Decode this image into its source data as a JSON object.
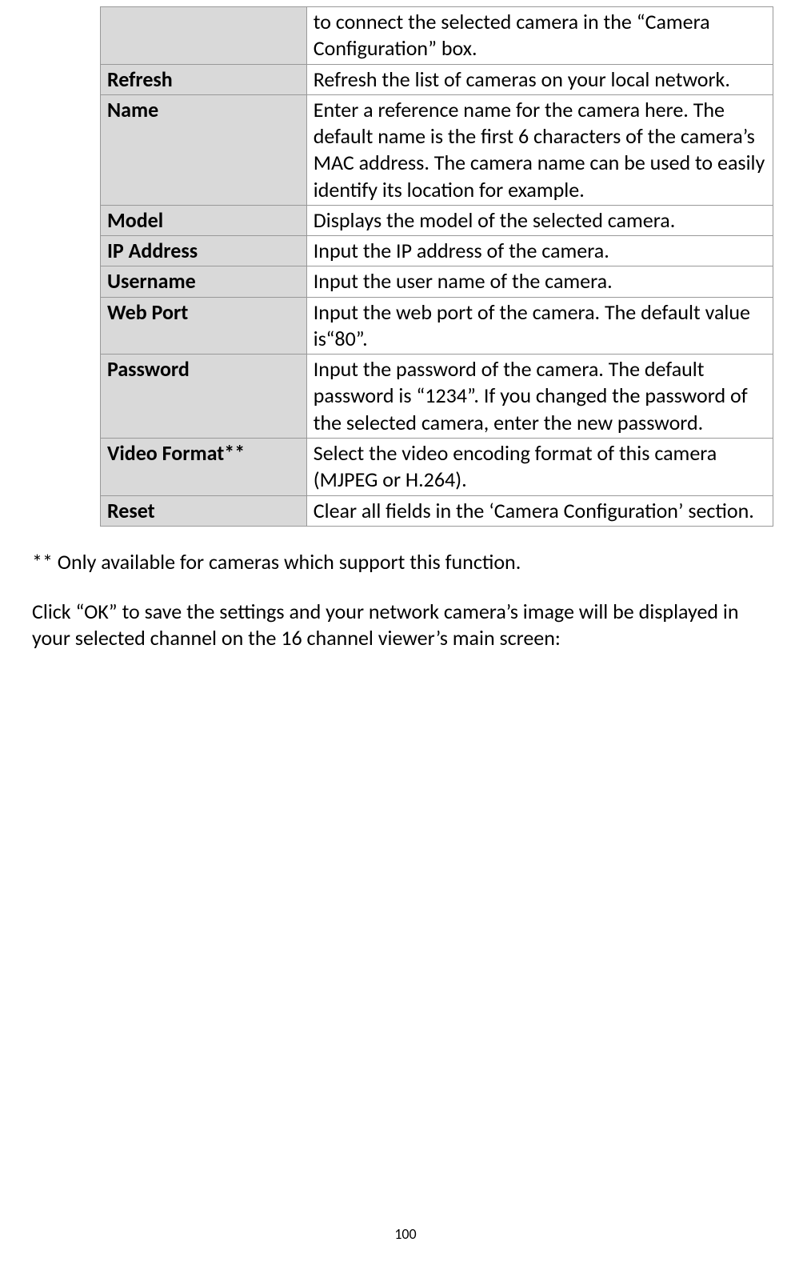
{
  "table": {
    "rows": [
      {
        "label": "",
        "desc": "to connect the selected camera in the “Camera Configuration” box."
      },
      {
        "label": "Refresh",
        "desc": "Refresh the list of cameras on your local network."
      },
      {
        "label": "Name",
        "desc": "Enter a reference name for the camera here. The default name is the first 6 characters of the camera’s MAC address. The camera name can be used to easily identify its location for example."
      },
      {
        "label": "Model",
        "desc": "Displays the model of the selected camera."
      },
      {
        "label": "IP Address",
        "desc": "Input the IP address of the camera."
      },
      {
        "label": "Username",
        "desc": "Input the user name of the camera."
      },
      {
        "label": "Web Port",
        "desc": "Input the web port of the camera. The default value is“80”."
      },
      {
        "label": "Password",
        "desc": "Input the password of the camera. The default password is “1234”. If you changed the password of the selected camera, enter the new password."
      },
      {
        "label": "Video Format**",
        "desc": "Select the video encoding format of this camera (MJPEG or H.264)."
      },
      {
        "label": "Reset",
        "desc": "Clear all fields in the ‘Camera Configuration’ section."
      }
    ]
  },
  "footnote": "** Only available for cameras which support this function.",
  "paragraph": "Click “OK” to save the settings and your network camera’s image will be displayed in your selected channel on the 16 channel viewer’s main screen:",
  "page_number": "100"
}
